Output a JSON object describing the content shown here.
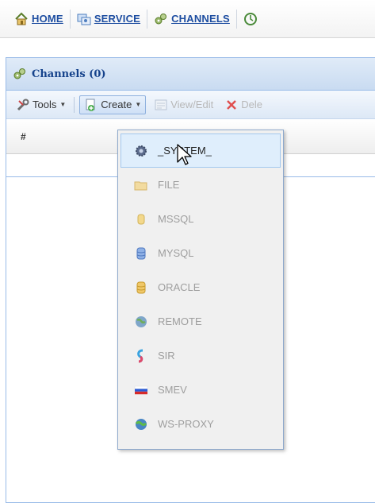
{
  "nav": {
    "items": [
      {
        "label": "HOME",
        "icon": "home-icon"
      },
      {
        "label": "SERVICE",
        "icon": "service-icon"
      },
      {
        "label": "CHANNELS",
        "icon": "channels-icon"
      }
    ]
  },
  "panel": {
    "title": "Channels (0)"
  },
  "toolbar": {
    "tools_label": "Tools",
    "create_label": "Create",
    "viewedit_label": "View/Edit",
    "delete_label": "Dele"
  },
  "grid": {
    "col_number": "#"
  },
  "menu": {
    "items": [
      {
        "label": "_SYSTEM_",
        "icon": "gear-icon",
        "active": true
      },
      {
        "label": "FILE",
        "icon": "folder-icon"
      },
      {
        "label": "MSSQL",
        "icon": "database-icon"
      },
      {
        "label": "MYSQL",
        "icon": "database-icon"
      },
      {
        "label": "ORACLE",
        "icon": "database-icon"
      },
      {
        "label": "REMOTE",
        "icon": "globe-icon"
      },
      {
        "label": "SIR",
        "icon": "sir-icon"
      },
      {
        "label": "SMEV",
        "icon": "flag-icon"
      },
      {
        "label": "WS-PROXY",
        "icon": "globe-icon"
      }
    ]
  },
  "colors": {
    "link": "#1e4ea1",
    "panel_title": "#15428b",
    "panel_border": "#99bbe8",
    "menu_active_bg": "#dfeefc",
    "disabled_text": "#9e9e9e"
  }
}
